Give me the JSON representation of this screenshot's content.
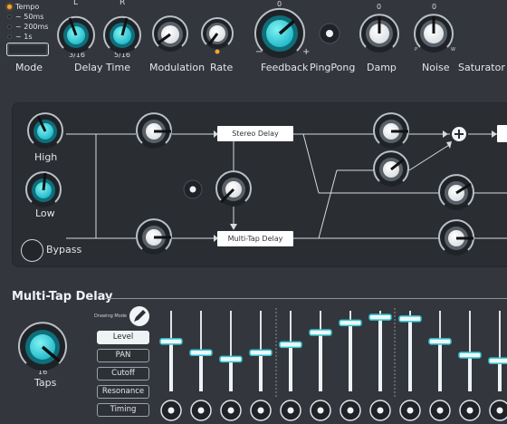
{
  "header": {
    "tempo_options": [
      "Tempo",
      "~ 50ms",
      "~ 200ms",
      "~ 1s"
    ],
    "tempo_selected": 0,
    "mode_label": "Mode",
    "delay_time": {
      "label": "Delay Time",
      "left_label": "L",
      "right_label": "R",
      "left_value": "3/16",
      "right_value": "5/16"
    },
    "modulation_label": "Modulation",
    "rate_label": "Rate",
    "feedback": {
      "label": "Feedback",
      "top_value": "0",
      "minus": "−",
      "plus": "+"
    },
    "pingpong_label": "PingPong",
    "damp": {
      "label": "Damp",
      "top_value": "0"
    },
    "noise": {
      "label": "Noise",
      "top_value": "0",
      "left_mark": "P",
      "right_mark": "W"
    },
    "saturator_label": "Saturator"
  },
  "routing": {
    "high_label": "High",
    "low_label": "Low",
    "bypass_label": "Bypass",
    "stereo_delay_label": "Stereo Delay",
    "multitap_delay_label": "Multi-Tap Delay",
    "sum_symbol": "+"
  },
  "multitap": {
    "title": "Multi-Tap Delay",
    "taps_value": "16",
    "taps_label": "Taps",
    "drawing_mode_label": "Drawing Mode",
    "modes": [
      {
        "label": "Level",
        "active": true
      },
      {
        "label": "PAN",
        "active": false
      },
      {
        "label": "Cutoff",
        "active": false
      },
      {
        "label": "Resonance",
        "active": false
      },
      {
        "label": "Timing",
        "active": false
      }
    ],
    "tap_levels": [
      0.62,
      0.48,
      0.4,
      0.48,
      0.58,
      0.73,
      0.85,
      0.92,
      0.9,
      0.62,
      0.45,
      0.38
    ]
  },
  "colors": {
    "background": "#33373d",
    "panel": "#2a2d32",
    "accent": "#2ec5d1",
    "indicator": "#f6a623"
  }
}
